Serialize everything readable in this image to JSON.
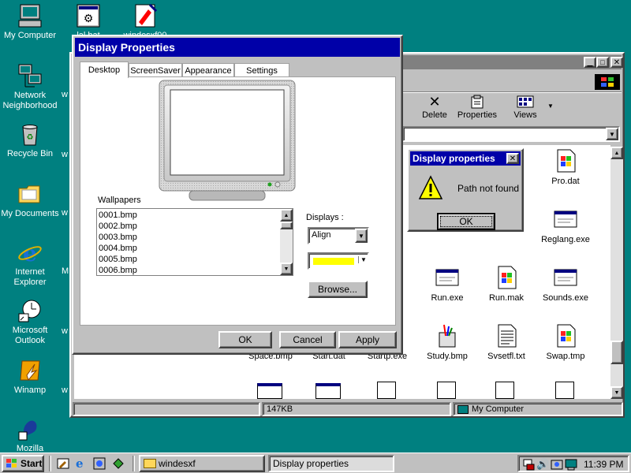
{
  "desktop": {
    "icons": [
      {
        "label": "My Computer"
      },
      {
        "label": "Network Neighborhood"
      },
      {
        "label": "Recycle Bin"
      },
      {
        "label": "My Documents"
      },
      {
        "label": "Internet Explorer"
      },
      {
        "label": "Microsoft Outlook"
      },
      {
        "label": "Winamp"
      },
      {
        "label": "Mozilla"
      }
    ],
    "top_icons": [
      {
        "label": "lal.bat"
      },
      {
        "label": "windesxf00"
      }
    ],
    "background_color": "#008080"
  },
  "explorer": {
    "toolbar": {
      "delete_label": "Delete",
      "properties_label": "Properties",
      "views_label": "Views"
    },
    "files_row1": [
      {
        "name": "Pro.dat",
        "icon": "dat-file-icon"
      }
    ],
    "files_row2": [
      {
        "name": "Reglang.exe",
        "icon": "exe-file-icon"
      }
    ],
    "files_row3": [
      {
        "name": "Run.exe",
        "icon": "exe-file-icon"
      },
      {
        "name": "Run.mak",
        "icon": "mak-file-icon"
      },
      {
        "name": "Sounds.exe",
        "icon": "exe-file-icon"
      }
    ],
    "files_row4": [
      {
        "name": "Space.bmp",
        "icon": "bmp-file-icon"
      },
      {
        "name": "Start.dat",
        "icon": "dat-file-icon"
      },
      {
        "name": "Startp.exe",
        "icon": "exe-file-icon"
      },
      {
        "name": "Study.bmp",
        "icon": "bmp-file-icon"
      },
      {
        "name": "Svsetfl.txt",
        "icon": "txt-file-icon"
      },
      {
        "name": "Swap.tmp",
        "icon": "tmp-file-icon"
      }
    ],
    "status": {
      "size": "147KB",
      "location": "My Computer"
    }
  },
  "display_properties": {
    "title": "Display Properties",
    "tabs": [
      "Desktop",
      "ScreenSaver",
      "Appearance",
      "Settings"
    ],
    "active_tab": "Desktop",
    "wallpapers_label": "Wallpapers",
    "wallpapers": [
      "0001.bmp",
      "0002.bmp",
      "0003.bmp",
      "0004.bmp",
      "0005.bmp",
      "0006.bmp"
    ],
    "displays_label": "Displays :",
    "displays_value": "Align",
    "color_value": "#ffff00",
    "browse_label": "Browse...",
    "ok_label": "OK",
    "cancel_label": "Cancel",
    "apply_label": "Apply"
  },
  "alert": {
    "title": "Display properties",
    "message": "Path not found",
    "ok_label": "OK"
  },
  "taskbar": {
    "start_label": "Start",
    "tasks": [
      {
        "label": "windesxf"
      },
      {
        "label": "Display properties"
      }
    ],
    "clock": "11:39 PM"
  },
  "colors": {
    "title_active": "#0000a8",
    "title_inactive": "#808080",
    "face": "#c0c0c0"
  }
}
